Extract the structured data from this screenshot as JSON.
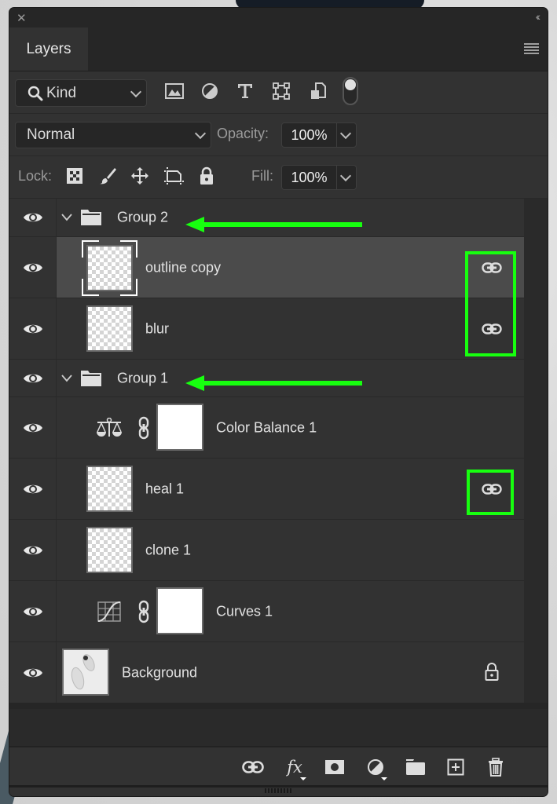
{
  "window": {
    "close_icon": "close-icon",
    "collapse_icon": "double-chevron-left-icon",
    "collapse_label": "‹‹"
  },
  "panel": {
    "tab_label": "Layers",
    "menu_icon": "hamburger-menu-icon"
  },
  "filter": {
    "kind_label": "Kind",
    "icons": [
      "pixel-layer-filter-icon",
      "adjustment-layer-filter-icon",
      "type-layer-filter-icon",
      "shape-layer-filter-icon",
      "smart-object-filter-icon",
      "filter-toggle-switch"
    ]
  },
  "blend": {
    "mode": "Normal",
    "opacity_label": "Opacity:",
    "opacity_value": "100%"
  },
  "lock": {
    "label": "Lock:",
    "icons": [
      "lock-transparent-pixels-icon",
      "lock-image-pixels-icon",
      "lock-position-icon",
      "lock-artboard-icon",
      "lock-all-icon"
    ],
    "fill_label": "Fill:",
    "fill_value": "100%"
  },
  "layers": [
    {
      "name": "Group 2",
      "type": "group",
      "expanded": true,
      "visible": true,
      "annotated_arrow": true
    },
    {
      "name": "outline copy",
      "type": "pixel",
      "visible": true,
      "selected": true,
      "linked": true
    },
    {
      "name": "blur",
      "type": "pixel",
      "visible": true,
      "linked": true
    },
    {
      "name": "Group 1",
      "type": "group",
      "expanded": true,
      "visible": true,
      "annotated_arrow": true
    },
    {
      "name": "Color Balance 1",
      "type": "adjustment-color-balance",
      "visible": true,
      "mask": true
    },
    {
      "name": "heal 1",
      "type": "pixel",
      "visible": true,
      "linked": true
    },
    {
      "name": "clone 1",
      "type": "pixel",
      "visible": true
    },
    {
      "name": "Curves 1",
      "type": "adjustment-curves",
      "visible": true,
      "mask": true
    },
    {
      "name": "Background",
      "type": "background",
      "visible": true,
      "locked": true
    }
  ],
  "footer": {
    "icons": [
      "link-layers-icon",
      "fx-layer-style-icon",
      "add-mask-icon",
      "new-adjustment-layer-icon",
      "new-group-icon",
      "new-layer-icon",
      "delete-layer-icon"
    ],
    "fx_label": "fx"
  },
  "annotations": {
    "color": "#17ff0f"
  }
}
